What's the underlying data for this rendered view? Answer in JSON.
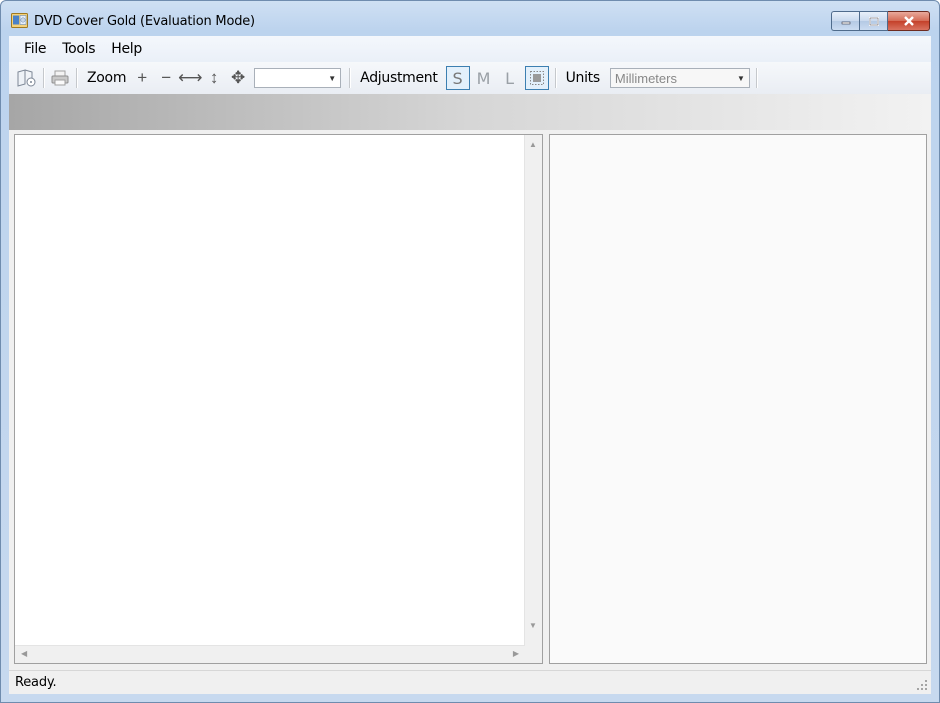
{
  "window": {
    "title": "DVD Cover Gold (Evaluation Mode)"
  },
  "menu": {
    "items": [
      "File",
      "Tools",
      "Help"
    ]
  },
  "toolbar": {
    "zoom_label": "Zoom",
    "zoom_in_glyph": "+",
    "zoom_out_glyph": "−",
    "fit_width_glyph": "⟷",
    "fit_height_glyph": "↕",
    "fit_page_glyph": "✥",
    "zoom_value": "",
    "adjustment_label": "Adjustment",
    "size_small": "S",
    "size_medium": "M",
    "size_large": "L",
    "units_label": "Units",
    "units_value": "Millimeters"
  },
  "status": {
    "text": "Ready."
  }
}
